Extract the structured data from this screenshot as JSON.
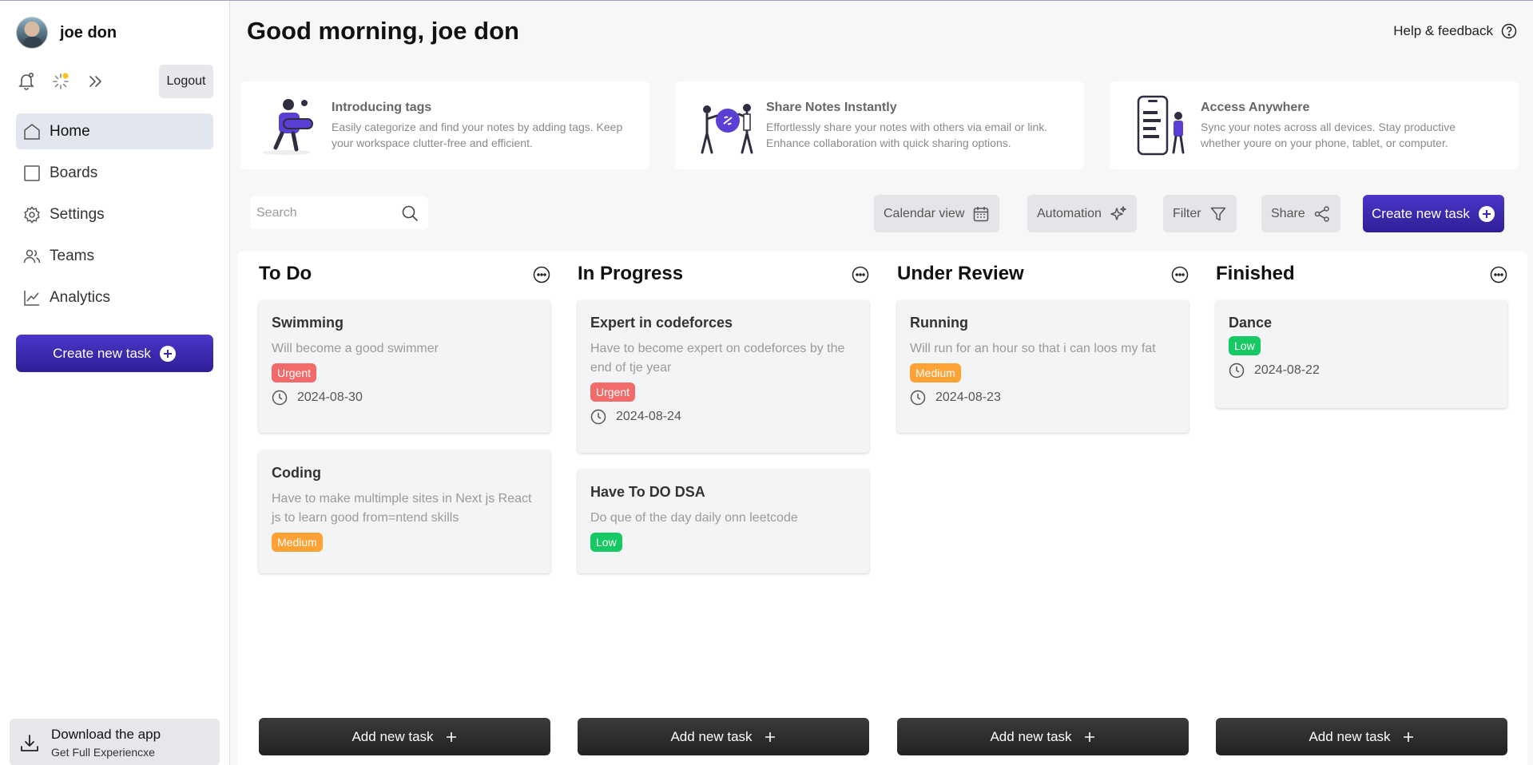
{
  "user": {
    "name": "joe don"
  },
  "sidebar": {
    "logout_label": "Logout",
    "nav": [
      {
        "label": "Home",
        "icon": "home-icon",
        "active": true
      },
      {
        "label": "Boards",
        "icon": "board-icon"
      },
      {
        "label": "Settings",
        "icon": "gear-icon"
      },
      {
        "label": "Teams",
        "icon": "users-icon"
      },
      {
        "label": "Analytics",
        "icon": "chart-icon"
      }
    ],
    "create_label": "Create new task",
    "download": {
      "title": "Download the app",
      "subtitle": "Get Full Experiencxe"
    }
  },
  "header": {
    "greeting": "Good morning, joe don",
    "help_label": "Help & feedback"
  },
  "features": [
    {
      "title": "Introducing tags",
      "desc": "Easily categorize and find your notes by adding tags. Keep your workspace clutter-free and efficient."
    },
    {
      "title": "Share Notes Instantly",
      "desc": "Effortlessly share your notes with others via email or link. Enhance collaboration with quick sharing options."
    },
    {
      "title": "Access Anywhere",
      "desc": "Sync your notes across all devices. Stay productive whether youre on your phone, tablet, or computer."
    }
  ],
  "toolbar": {
    "search_placeholder": "Search",
    "calendar_label": "Calendar view",
    "automation_label": "Automation",
    "filter_label": "Filter",
    "share_label": "Share",
    "create_label": "Create new task"
  },
  "colors": {
    "accent": "#3a27b0",
    "urgent": "#f26b6b",
    "medium": "#ffa235",
    "low": "#17c964"
  },
  "columns": [
    {
      "title": "To Do",
      "add_label": "Add new task",
      "cards": [
        {
          "title": "Swimming",
          "desc": "Will become a good swimmer",
          "priority": "Urgent",
          "date": "2024-08-30"
        },
        {
          "title": "Coding",
          "desc": "Have to make multimple sites in Next js React js to learn good from=ntend skills",
          "priority": "Medium",
          "date": ""
        }
      ]
    },
    {
      "title": "In Progress",
      "add_label": "Add new task",
      "cards": [
        {
          "title": "Expert in codeforces",
          "desc": "Have to become expert on codeforces by the end of tje year",
          "priority": "Urgent",
          "date": "2024-08-24"
        },
        {
          "title": "Have To DO DSA",
          "desc": "Do que of the day daily onn leetcode",
          "priority": "Low",
          "date": ""
        }
      ]
    },
    {
      "title": "Under Review",
      "add_label": "Add new task",
      "cards": [
        {
          "title": "Running",
          "desc": "Will run for an hour so that i can loos my fat",
          "priority": "Medium",
          "date": "2024-08-23"
        }
      ]
    },
    {
      "title": "Finished",
      "add_label": "Add new task",
      "cards": [
        {
          "title": "Dance",
          "desc": "",
          "priority": "Low",
          "date": "2024-08-22"
        }
      ]
    }
  ]
}
